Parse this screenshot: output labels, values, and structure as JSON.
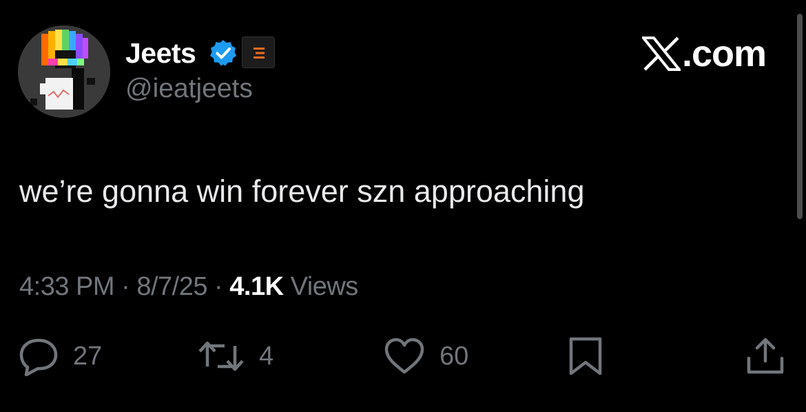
{
  "author": {
    "display_name": "Jeets",
    "handle": "@ieatjeets",
    "avatar_icon": "pixel-character-avatar",
    "verified_icon": "verified-badge-icon",
    "affiliate_icon": "affiliate-badge-icon"
  },
  "site": {
    "logo_text": ".com",
    "logo_icon": "x-logo-icon"
  },
  "tweet": {
    "text": "we’re gonna win forever szn approaching",
    "time": "4:33 PM",
    "separator": "·",
    "date": "8/7/25",
    "views_count": "4.1K",
    "views_label": "Views"
  },
  "actions": {
    "reply_count": "27",
    "retweet_count": "4",
    "like_count": "60"
  },
  "colors": {
    "background": "#000000",
    "primary_text": "#e7e9ea",
    "secondary_text": "#71767b",
    "verified_blue": "#1d9bf0",
    "affiliate_orange": "#f26b1d"
  }
}
